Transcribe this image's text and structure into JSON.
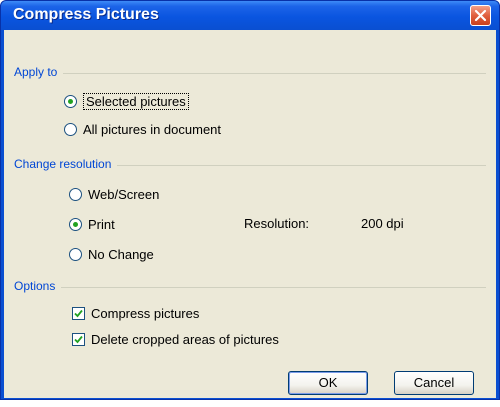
{
  "window": {
    "title": "Compress Pictures"
  },
  "apply_to": {
    "label": "Apply to",
    "options": [
      {
        "label": "Selected pictures",
        "selected": true
      },
      {
        "label": "All pictures in document",
        "selected": false
      }
    ]
  },
  "change_resolution": {
    "label": "Change resolution",
    "options": [
      {
        "label": "Web/Screen",
        "selected": false
      },
      {
        "label": "Print",
        "selected": true
      },
      {
        "label": "No Change",
        "selected": false
      }
    ],
    "resolution_label": "Resolution:",
    "resolution_value": "200 dpi"
  },
  "options": {
    "label": "Options",
    "checkboxes": [
      {
        "label": "Compress pictures",
        "checked": true
      },
      {
        "label": "Delete cropped areas of pictures",
        "checked": true
      }
    ]
  },
  "buttons": {
    "ok": "OK",
    "cancel": "Cancel"
  },
  "colors": {
    "title_bar": "#0a4fd1",
    "group_label": "#0046d5",
    "radio_dot": "#21a121",
    "check_mark": "#21a121",
    "dialog_bg": "#ece9d8"
  }
}
